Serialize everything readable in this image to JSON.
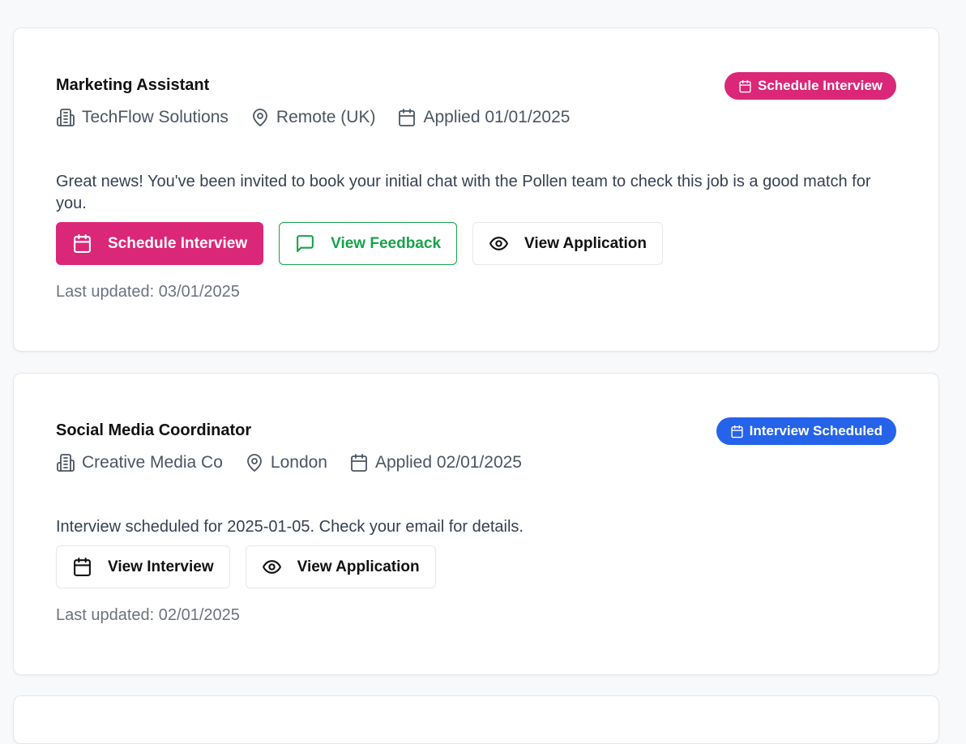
{
  "colors": {
    "accent_pink": "#db2777",
    "accent_blue": "#2563eb",
    "success_green": "#16a34a"
  },
  "applications": [
    {
      "title": "Marketing Assistant",
      "status": {
        "label": "Schedule Interview",
        "icon": "calendar-icon",
        "color": "#db2777"
      },
      "company": "TechFlow Solutions",
      "location": "Remote (UK)",
      "applied": "Applied 01/01/2025",
      "message": "Great news! You've been invited to book your initial chat with the Pollen team to check this job is a good match for you.",
      "actions": [
        {
          "label": "Schedule Interview",
          "icon": "calendar-icon"
        },
        {
          "label": "View Feedback",
          "icon": "message-square-icon"
        },
        {
          "label": "View Application",
          "icon": "eye-icon"
        }
      ],
      "last_updated": "Last updated: 03/01/2025"
    },
    {
      "title": "Social Media Coordinator",
      "status": {
        "label": "Interview Scheduled",
        "icon": "calendar-icon",
        "color": "#2563eb"
      },
      "company": "Creative Media Co",
      "location": "London",
      "applied": "Applied 02/01/2025",
      "message": "Interview scheduled for 2025-01-05. Check your email for details.",
      "actions": [
        {
          "label": "View Interview",
          "icon": "calendar-icon"
        },
        {
          "label": "View Application",
          "icon": "eye-icon"
        }
      ],
      "last_updated": "Last updated: 02/01/2025"
    }
  ]
}
